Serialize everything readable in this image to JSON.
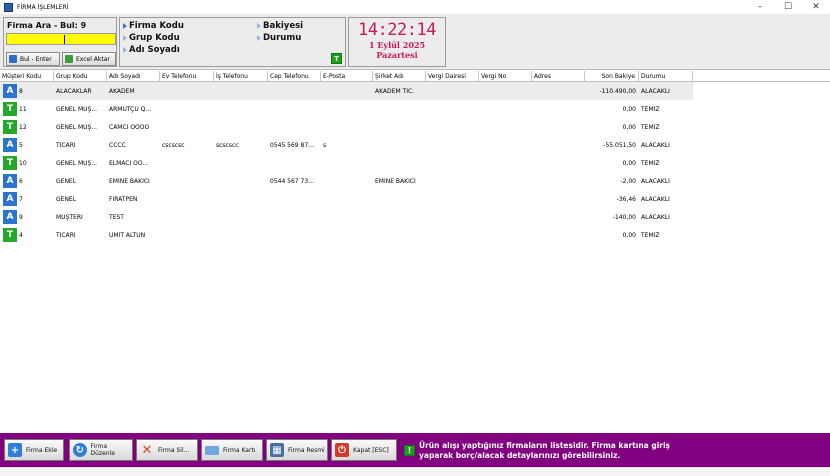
{
  "window": {
    "title": "FİRMA İŞLEMLERİ",
    "controls": [
      "–",
      "☐",
      "✕"
    ]
  },
  "search": {
    "title": "Firma Ara - Bul: 9",
    "value": "",
    "find_button": "Bul - Enter",
    "excel_button": "Excel Aktar"
  },
  "fields": {
    "firma_kodu": "Firma Kodu",
    "grup_kodu": "Grup Kodu",
    "adi_soyadi": "Adı Soyadı",
    "bakiyesi": "Bakiyesi",
    "durumu": "Durumu",
    "badge": "T"
  },
  "clock": {
    "time": "14:22:14",
    "date": "1 Eylül 2025",
    "day": "Pazartesi"
  },
  "table": {
    "columns": [
      "Müşteri Kodu",
      "Grup Kodu",
      "Adı Soyadı",
      "Ev Telefonu",
      "İş Telefonu",
      "Cep Telefonu",
      "E-Posta",
      "Şirket Adı",
      "Vergi Dairesi",
      "Vergi No",
      "Adres",
      "Son Bakiye",
      "Durumu"
    ],
    "rows": [
      {
        "badge": "A",
        "kod": "8",
        "grup": "ALACAKLAR",
        "ad": "AKADEM",
        "ev": "",
        "is": "",
        "cep": "",
        "eposta": "",
        "sirket": "AKADEM TİC.",
        "vd": "",
        "vno": "",
        "adres": "",
        "bakiye": "-110.490,00",
        "durum": "ALACAKLI"
      },
      {
        "badge": "T",
        "kod": "11",
        "grup": "GENEL MÜŞ...",
        "ad": "ARMUTÇU Q...",
        "ev": "",
        "is": "",
        "cep": "",
        "eposta": "",
        "sirket": "",
        "vd": "",
        "vno": "",
        "adres": "",
        "bakiye": "0,00",
        "durum": "TEMİZ"
      },
      {
        "badge": "T",
        "kod": "12",
        "grup": "GENEL MÜŞ...",
        "ad": "CAMCI ÖÖÖÖ",
        "ev": "",
        "is": "",
        "cep": "",
        "eposta": "",
        "sirket": "",
        "vd": "",
        "vno": "",
        "adres": "",
        "bakiye": "0,00",
        "durum": "TEMİZ"
      },
      {
        "badge": "A",
        "kod": "5",
        "grup": "TİCARİ",
        "ad": "CCCC",
        "ev": "cscscsc",
        "is": "scscscc",
        "cep": "0545 569 87...",
        "eposta": "s",
        "sirket": "",
        "vd": "",
        "vno": "",
        "adres": "",
        "bakiye": "-55.051,50",
        "durum": "ALACAKLI"
      },
      {
        "badge": "T",
        "kod": "10",
        "grup": "GENEL MÜŞ...",
        "ad": "ELMACI OO...",
        "ev": "",
        "is": "",
        "cep": "",
        "eposta": "",
        "sirket": "",
        "vd": "",
        "vno": "",
        "adres": "",
        "bakiye": "0,00",
        "durum": "TEMİZ"
      },
      {
        "badge": "A",
        "kod": "6",
        "grup": "GENEL",
        "ad": "EMİNE BAKICI",
        "ev": "",
        "is": "",
        "cep": "0544 567 73...",
        "eposta": "",
        "sirket": "EMİNE BAKICI",
        "vd": "",
        "vno": "",
        "adres": "",
        "bakiye": "-2,00",
        "durum": "ALACAKLI"
      },
      {
        "badge": "A",
        "kod": "7",
        "grup": "GENEL",
        "ad": "FIRATPEN",
        "ev": "",
        "is": "",
        "cep": "",
        "eposta": "",
        "sirket": "",
        "vd": "",
        "vno": "",
        "adres": "",
        "bakiye": "-36,46",
        "durum": "ALACAKLI"
      },
      {
        "badge": "A",
        "kod": "9",
        "grup": "MÜŞTERİ",
        "ad": "TEST",
        "ev": "",
        "is": "",
        "cep": "",
        "eposta": "",
        "sirket": "",
        "vd": "",
        "vno": "",
        "adres": "",
        "bakiye": "-140,00",
        "durum": "ALACAKLI"
      },
      {
        "badge": "T",
        "kod": "4",
        "grup": "TİCARİ",
        "ad": "ÜMİT ALTUN",
        "ev": "",
        "is": "",
        "cep": "",
        "eposta": "",
        "sirket": "",
        "vd": "",
        "vno": "",
        "adres": "",
        "bakiye": "0,00",
        "durum": "TEMİZ"
      }
    ]
  },
  "bottom": {
    "buttons": [
      "Firma Ekle",
      "Firma Düzenle",
      "Firma Sil...",
      "Firma Kartı",
      "Firma Resmi",
      "Kapat [ESC]"
    ],
    "info_badge": "!",
    "info": "Ürün alışı yaptığınız firmaların listesidir. Firma kartına giriş yaparak borç/alacak detaylarınızı görebilirsiniz."
  },
  "colors": {
    "accent": "#c8195a",
    "bottom_bar": "#800080",
    "search_bg": "#ffff00",
    "badge_A": "#2a73cf",
    "badge_T": "#23a829"
  }
}
